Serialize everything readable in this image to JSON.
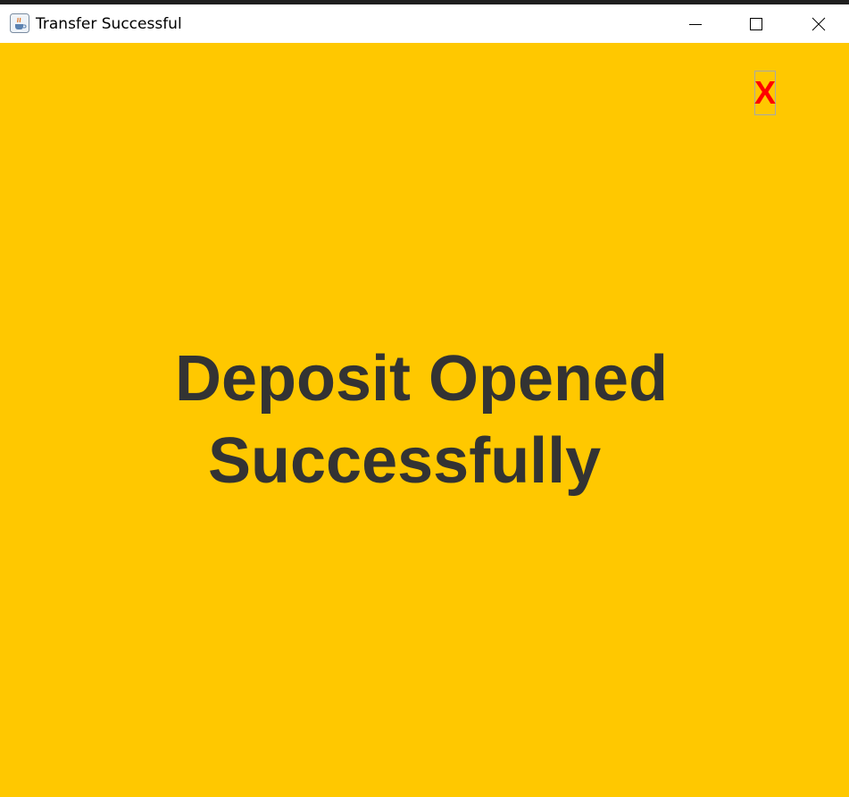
{
  "window": {
    "title": "Transfer Successful",
    "icon": "java-cup-icon",
    "controls": {
      "minimize_icon": "minimize-icon",
      "maximize_icon": "maximize-icon",
      "close_icon": "close-icon"
    }
  },
  "dialog": {
    "background_color": "#ffc800",
    "close_button_label": "X",
    "close_button_color": "#ff0000",
    "message_line_1": "Deposit Opened",
    "message_line_2": "Successfully",
    "message_color": "#333333"
  }
}
